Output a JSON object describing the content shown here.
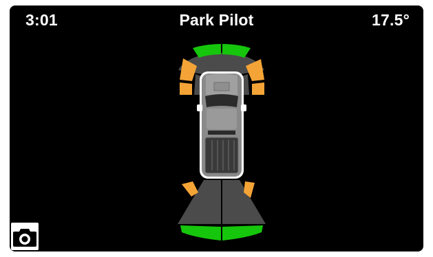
{
  "status": {
    "time": "3:01",
    "title": "Park Pilot",
    "temperature": "17.5°"
  },
  "colors": {
    "background": "#000000",
    "zone_clear": "#16c60c",
    "zone_warning": "#f4a436",
    "zone_inactive": "#4b4b4b",
    "vehicle_body": "#8a8a8a"
  },
  "sensors": {
    "front": {
      "center_left": "clear",
      "center_right": "clear",
      "outer_left": "warning",
      "outer_right": "warning"
    },
    "rear": {
      "center_left": "clear",
      "center_right": "clear",
      "outer_left": "warning",
      "outer_right": "warning"
    }
  },
  "icons": {
    "camera_button": "camera-icon"
  }
}
